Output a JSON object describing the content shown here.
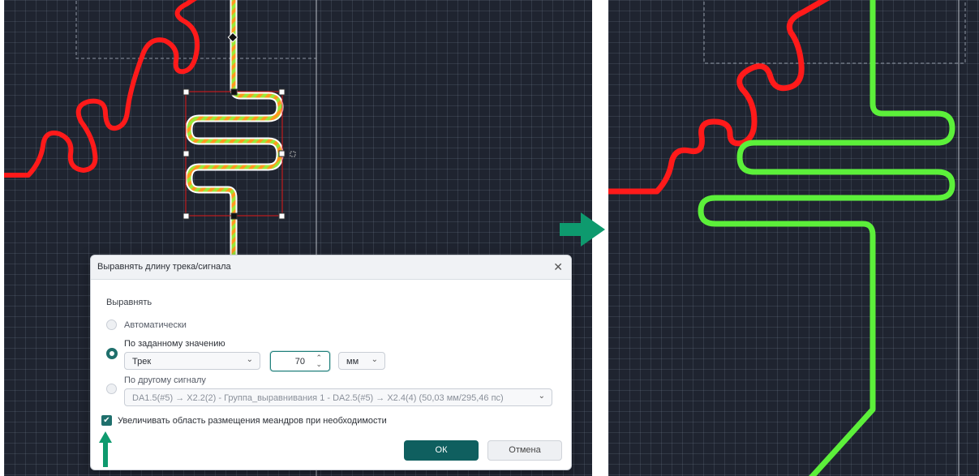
{
  "dialog": {
    "title": "Выравнять длину трека/сигнала",
    "section_label": "Выравнять",
    "options": {
      "auto": "Автоматически",
      "by_value": "По заданному значению",
      "by_signal": "По другому сигналу"
    },
    "target_select": "Трек",
    "value_input": "70",
    "unit_select": "мм",
    "signal_select": "DA1.5(#5) → X2.2(2) - Группа_выравнивания 1 - DA2.5(#5) → X2.4(4) (50,03 мм/295,46 пс)",
    "checkbox_label": "Увеличивать область размещения меандров при необходимости",
    "checkbox_checked": true,
    "ok_label": "ОК",
    "cancel_label": "Отмена"
  },
  "colors": {
    "board_background": "#1f2430",
    "red_track": "#ff1a1a",
    "green_track": "#5cf03a",
    "accent": "#0f5f5f",
    "arrow": "#0e9a6e"
  },
  "icons": {
    "close": "close-icon",
    "chevron": "chevron-down-icon",
    "spin": "spinner-arrows-icon",
    "check": "checkmark-icon"
  }
}
